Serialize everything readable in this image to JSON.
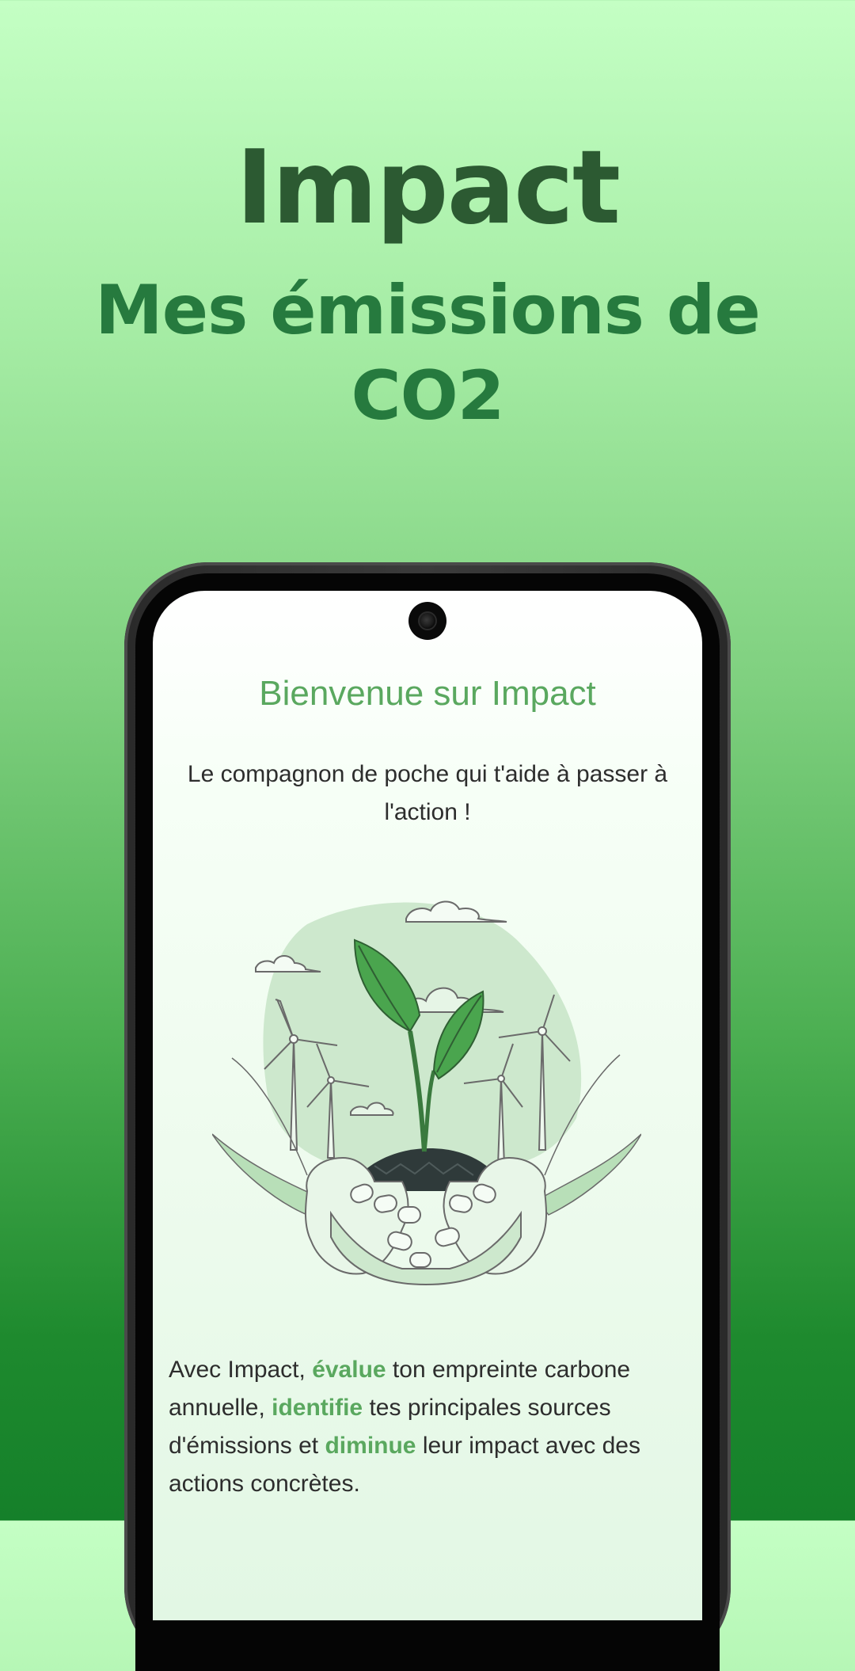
{
  "hero": {
    "title": "Impact",
    "subtitle": "Mes émissions de CO2"
  },
  "screen": {
    "welcome": "Bienvenue sur Impact",
    "tagline": "Le compagnon de poche qui t'aide à passer à l'action !",
    "description": {
      "part1": "Avec Impact, ",
      "highlight1": "évalue",
      "part2": " ton empreinte carbone annuelle, ",
      "highlight2": "identifie",
      "part3": " tes principales sources d'émissions et ",
      "highlight3": "diminue",
      "part4": " leur impact avec des actions concrètes."
    }
  },
  "colors": {
    "accent_green": "#5aa85f",
    "title_dark_green": "#2c5a32",
    "subtitle_green": "#267a3e"
  },
  "illustration": {
    "icon": "hands-holding-sprout-with-wind-turbines-icon"
  }
}
